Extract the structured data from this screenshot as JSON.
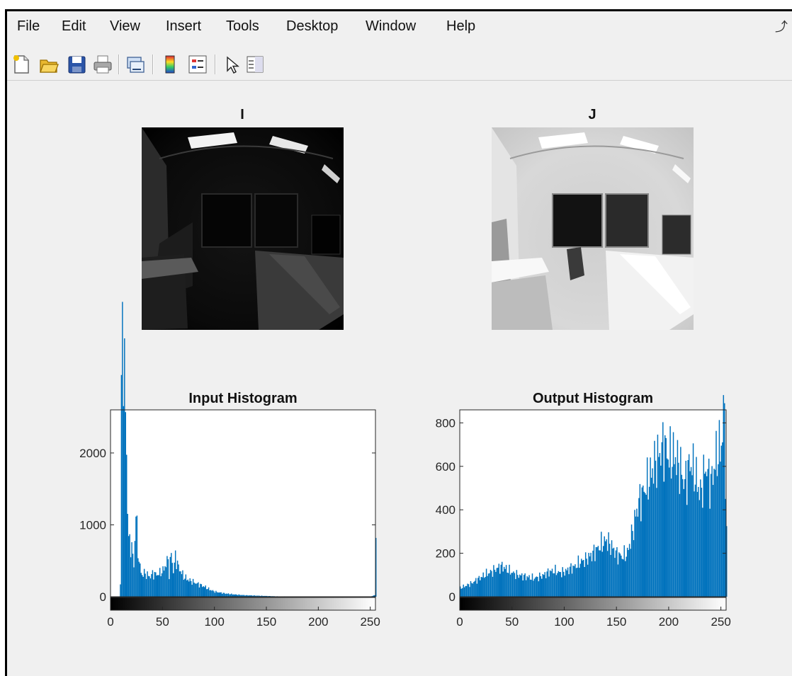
{
  "menubar": {
    "items": [
      "File",
      "Edit",
      "View",
      "Insert",
      "Tools",
      "Desktop",
      "Window",
      "Help"
    ]
  },
  "toolbar": {
    "buttons": [
      {
        "icon": "new-figure-icon"
      },
      {
        "icon": "open-file-icon"
      },
      {
        "icon": "save-figure-icon"
      },
      {
        "icon": "print-figure-icon"
      },
      {
        "icon": "link-plot-icon"
      },
      {
        "icon": "insert-colorbar-icon"
      },
      {
        "icon": "insert-legend-icon"
      },
      {
        "icon": "edit-plot-cursor-icon"
      },
      {
        "icon": "property-inspector-icon"
      }
    ]
  },
  "colors": {
    "bar": "#0072bd",
    "figure_bg": "#f0f0f0",
    "axes_bg": "#ffffff"
  },
  "images": [
    {
      "title": "I",
      "description": "dark grayscale fisheye photo of an office"
    },
    {
      "title": "J",
      "description": "bright histogram-equalized version of the same photo"
    }
  ],
  "chart_data": [
    {
      "type": "bar",
      "title": "Input Histogram",
      "xlim": [
        0,
        255
      ],
      "ylim": [
        0,
        2600
      ],
      "xticks": [
        "0",
        "50",
        "100",
        "150",
        "200",
        "250"
      ],
      "yticks": [
        "0",
        "1000",
        "2000"
      ],
      "colorbar": "grayscale 0-255",
      "series": [
        {
          "x": [
            0,
            2,
            4,
            6,
            8,
            9,
            10,
            11,
            12,
            13,
            14,
            15,
            16,
            17,
            18,
            20,
            22,
            24,
            26,
            28,
            30,
            32,
            35,
            38,
            40,
            45,
            50,
            55,
            56,
            58,
            60,
            62,
            65,
            70,
            75,
            80,
            85,
            90,
            95,
            100,
            110,
            120,
            130,
            140,
            150,
            160,
            180,
            200,
            220,
            240,
            250,
            254,
            255
          ],
          "values": [
            0,
            0,
            0,
            0,
            0,
            200,
            2600,
            4100,
            3300,
            3100,
            2600,
            1950,
            1300,
            800,
            750,
            700,
            420,
            1200,
            640,
            400,
            300,
            330,
            300,
            280,
            320,
            310,
            360,
            520,
            310,
            620,
            350,
            560,
            410,
            280,
            230,
            200,
            170,
            140,
            100,
            70,
            45,
            30,
            20,
            15,
            10,
            5,
            3,
            2,
            1,
            1,
            0,
            25,
            680
          ]
        }
      ]
    },
    {
      "type": "bar",
      "title": "Output Histogram",
      "xlim": [
        0,
        255
      ],
      "ylim": [
        0,
        860
      ],
      "xticks": [
        "0",
        "50",
        "100",
        "150",
        "200",
        "250"
      ],
      "yticks": [
        "0",
        "200",
        "400",
        "600",
        "800"
      ],
      "colorbar": "grayscale 0-255",
      "series": [
        {
          "x": [
            0,
            5,
            10,
            15,
            20,
            25,
            30,
            35,
            40,
            45,
            50,
            55,
            60,
            65,
            70,
            75,
            80,
            85,
            90,
            95,
            100,
            105,
            110,
            115,
            120,
            125,
            130,
            135,
            140,
            145,
            150,
            155,
            160,
            165,
            170,
            175,
            180,
            185,
            190,
            195,
            200,
            205,
            210,
            215,
            220,
            225,
            230,
            235,
            240,
            245,
            250,
            253,
            255
          ],
          "values": [
            40,
            50,
            60,
            75,
            90,
            105,
            115,
            130,
            140,
            125,
            110,
            100,
            95,
            90,
            85,
            90,
            100,
            115,
            120,
            110,
            115,
            130,
            140,
            160,
            170,
            190,
            215,
            240,
            260,
            230,
            195,
            185,
            200,
            300,
            420,
            480,
            530,
            600,
            650,
            700,
            640,
            650,
            600,
            520,
            620,
            560,
            470,
            600,
            520,
            640,
            700,
            880,
            270
          ]
        }
      ]
    }
  ]
}
